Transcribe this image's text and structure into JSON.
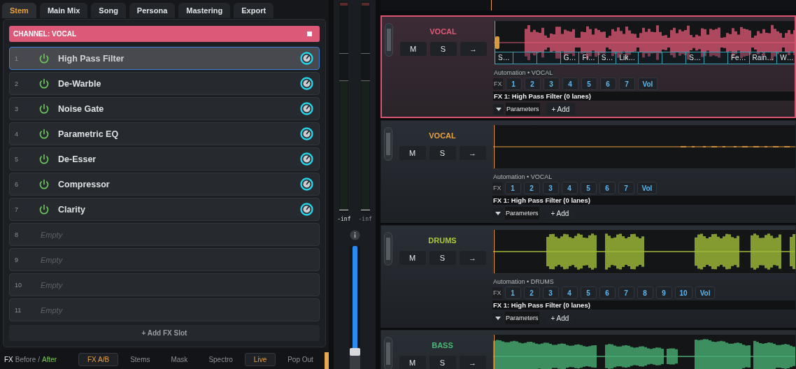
{
  "tabs": [
    {
      "label": "Stem",
      "selected": true
    },
    {
      "label": "Main Mix",
      "selected": false
    },
    {
      "label": "Song",
      "selected": false
    },
    {
      "label": "Persona",
      "selected": false
    },
    {
      "label": "Mastering",
      "selected": false
    },
    {
      "label": "Export",
      "selected": false
    }
  ],
  "channel": {
    "title": "CHANNEL: VOCAL",
    "color": "#dc5a78"
  },
  "fx_slots": [
    {
      "number": "1",
      "name": "High Pass Filter",
      "kind": "effect",
      "on": true,
      "selected": true
    },
    {
      "number": "2",
      "name": "De-Warble",
      "kind": "effect",
      "on": true,
      "selected": false
    },
    {
      "number": "3",
      "name": "Noise Gate",
      "kind": "effect",
      "on": true,
      "selected": false
    },
    {
      "number": "4",
      "name": "Parametric EQ",
      "kind": "effect",
      "on": true,
      "selected": false
    },
    {
      "number": "5",
      "name": "De-Esser",
      "kind": "effect",
      "on": true,
      "selected": false
    },
    {
      "number": "6",
      "name": "Compressor",
      "kind": "effect",
      "on": true,
      "selected": false
    },
    {
      "number": "7",
      "name": "Clarity",
      "kind": "effect",
      "on": true,
      "selected": false
    },
    {
      "number": "8",
      "name": "Empty",
      "kind": "empty",
      "selected": false
    },
    {
      "number": "9",
      "name": "Empty",
      "kind": "empty",
      "selected": false
    },
    {
      "number": "10",
      "name": "Empty",
      "kind": "empty",
      "selected": false
    },
    {
      "number": "11",
      "name": "Empty",
      "kind": "empty",
      "selected": false
    }
  ],
  "add_slot": "+ Add FX Slot",
  "compare": {
    "prefix": "FX",
    "separator": "/",
    "options": [
      {
        "label": "Before",
        "selected": false
      },
      {
        "label": "After",
        "selected": true
      }
    ]
  },
  "view_buttons": [
    {
      "label": "FX A/B",
      "active": true
    },
    {
      "label": "Stems",
      "active": false
    },
    {
      "label": "Mask",
      "active": false
    },
    {
      "label": "Spectro",
      "active": false
    },
    {
      "label": "Live",
      "active": true
    },
    {
      "label": "Pop Out",
      "active": false
    }
  ],
  "mixer": {
    "readings": [
      "-inf",
      "-inf"
    ],
    "fader": {
      "level": 0.15
    }
  },
  "tracks": [
    {
      "name": "VOCAL",
      "color": "#e05a78",
      "selected": true,
      "kind": "bars",
      "buttons": [
        "M",
        "S",
        "→"
      ],
      "segments": [
        {
          "kind": "label",
          "label": "S…"
        },
        {
          "kind": "blank"
        },
        {
          "kind": "blank"
        },
        {
          "kind": "label",
          "label": "G…"
        },
        {
          "kind": "label",
          "label": "Fi…"
        },
        {
          "kind": "label",
          "label": "S…"
        },
        {
          "kind": "label",
          "label": "Lik…"
        },
        {
          "kind": "blank"
        },
        {
          "kind": "blank"
        },
        {
          "kind": "label",
          "label": "S…"
        },
        {
          "kind": "blank"
        },
        {
          "kind": "label",
          "label": "Fe…"
        },
        {
          "kind": "label",
          "label": "Rain…"
        },
        {
          "kind": "label",
          "label": "W…"
        }
      ],
      "automation": "Automation • VOCAL",
      "fx_label": "FX",
      "fx_buttons": [
        "1",
        "2",
        "3",
        "4",
        "5",
        "6",
        "7",
        "Vol"
      ],
      "fx_info": "FX 1: High Pass Filter (0 lanes)",
      "parameters": "Parameters",
      "add": "+ Add"
    },
    {
      "name": "VOCAL",
      "color": "#e8a040",
      "selected": false,
      "kind": "flat",
      "buttons": [
        "M",
        "S",
        "→"
      ],
      "automation": "Automation • VOCAL",
      "fx_label": "FX",
      "fx_buttons": [
        "1",
        "2",
        "3",
        "4",
        "5",
        "6",
        "7",
        "Vol"
      ],
      "fx_info": "FX 1: High Pass Filter (0 lanes)",
      "parameters": "Parameters",
      "add": "+ Add"
    },
    {
      "name": "DRUMS",
      "color": "#a8c83a",
      "selected": false,
      "kind": "blocks",
      "buttons": [
        "M",
        "S",
        "→"
      ],
      "automation": "Automation • DRUMS",
      "fx_label": "FX",
      "fx_buttons": [
        "1",
        "2",
        "3",
        "4",
        "5",
        "6",
        "7",
        "8",
        "9",
        "10",
        "Vol"
      ],
      "fx_info": "FX 1: High Pass Filter (0 lanes)",
      "parameters": "Parameters",
      "add": "+ Add"
    },
    {
      "name": "BASS",
      "color": "#4cb878",
      "selected": false,
      "kind": "smooth",
      "buttons": [
        "M",
        "S",
        "→"
      ]
    }
  ]
}
